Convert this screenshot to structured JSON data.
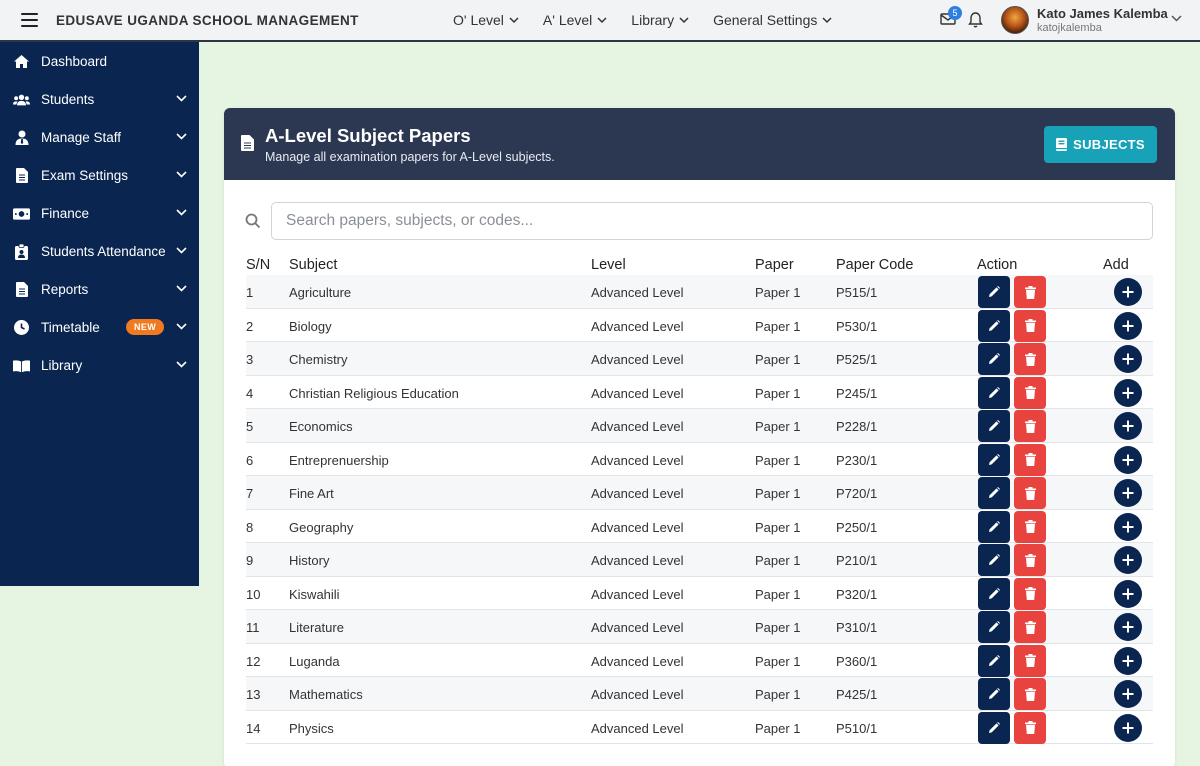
{
  "app": {
    "brand": "EDUSAVE UGANDA SCHOOL MANAGEMENT",
    "nav": [
      "O' Level",
      "A' Level",
      "Library",
      "General Settings"
    ],
    "mail_count": "5",
    "user": {
      "name": "Kato James Kalemba",
      "handle": "katojkalemba"
    }
  },
  "sidebar": {
    "items": [
      {
        "label": "Dashboard",
        "icon": "home-icon",
        "has_submenu": false
      },
      {
        "label": "Students",
        "icon": "users-icon",
        "has_submenu": true
      },
      {
        "label": "Manage Staff",
        "icon": "user-tie-icon",
        "has_submenu": true
      },
      {
        "label": "Exam Settings",
        "icon": "file-icon",
        "has_submenu": true
      },
      {
        "label": "Finance",
        "icon": "money-icon",
        "has_submenu": true
      },
      {
        "label": "Students Attendance",
        "icon": "clipboard-user-icon",
        "has_submenu": true
      },
      {
        "label": "Reports",
        "icon": "file-lines-icon",
        "has_submenu": true
      },
      {
        "label": "Timetable",
        "icon": "clock-icon",
        "has_submenu": true,
        "badge": "NEW"
      },
      {
        "label": "Library",
        "icon": "book-open-icon",
        "has_submenu": true
      }
    ]
  },
  "card": {
    "title": "A-Level Subject Papers",
    "subtitle": "Manage all examination papers for A-Level subjects.",
    "subjects_button": "SUBJECTS",
    "search_placeholder": "Search papers, subjects, or codes..."
  },
  "table": {
    "headers": {
      "sn": "S/N",
      "subject": "Subject",
      "level": "Level",
      "paper": "Paper",
      "code": "Paper Code",
      "action": "Action",
      "add": "Add"
    },
    "rows": [
      {
        "sn": "1",
        "subject": "Agriculture",
        "level": "Advanced Level",
        "paper": "Paper 1",
        "code": "P515/1"
      },
      {
        "sn": "2",
        "subject": "Biology",
        "level": "Advanced Level",
        "paper": "Paper 1",
        "code": "P530/1"
      },
      {
        "sn": "3",
        "subject": "Chemistry",
        "level": "Advanced Level",
        "paper": "Paper 1",
        "code": "P525/1"
      },
      {
        "sn": "4",
        "subject": "Christian Religious Education",
        "level": "Advanced Level",
        "paper": "Paper 1",
        "code": "P245/1"
      },
      {
        "sn": "5",
        "subject": "Economics",
        "level": "Advanced Level",
        "paper": "Paper 1",
        "code": "P228/1"
      },
      {
        "sn": "6",
        "subject": "Entreprenuership",
        "level": "Advanced Level",
        "paper": "Paper 1",
        "code": "P230/1"
      },
      {
        "sn": "7",
        "subject": "Fine Art",
        "level": "Advanced Level",
        "paper": "Paper 1",
        "code": "P720/1"
      },
      {
        "sn": "8",
        "subject": "Geography",
        "level": "Advanced Level",
        "paper": "Paper 1",
        "code": "P250/1"
      },
      {
        "sn": "9",
        "subject": "History",
        "level": "Advanced Level",
        "paper": "Paper 1",
        "code": "P210/1"
      },
      {
        "sn": "10",
        "subject": "Kiswahili",
        "level": "Advanced Level",
        "paper": "Paper 1",
        "code": "P320/1"
      },
      {
        "sn": "11",
        "subject": "Literature",
        "level": "Advanced Level",
        "paper": "Paper 1",
        "code": "P310/1"
      },
      {
        "sn": "12",
        "subject": "Luganda",
        "level": "Advanced Level",
        "paper": "Paper 1",
        "code": "P360/1"
      },
      {
        "sn": "13",
        "subject": "Mathematics",
        "level": "Advanced Level",
        "paper": "Paper 1",
        "code": "P425/1"
      },
      {
        "sn": "14",
        "subject": "Physics",
        "level": "Advanced Level",
        "paper": "Paper 1",
        "code": "P510/1"
      }
    ]
  },
  "colors": {
    "sidebar_bg": "#0a2550",
    "header_bg": "#2c3852",
    "accent_teal": "#17a2b8",
    "delete_red": "#e9433f",
    "page_bg": "#e6f5e1",
    "badge_orange": "#f07a1f"
  }
}
